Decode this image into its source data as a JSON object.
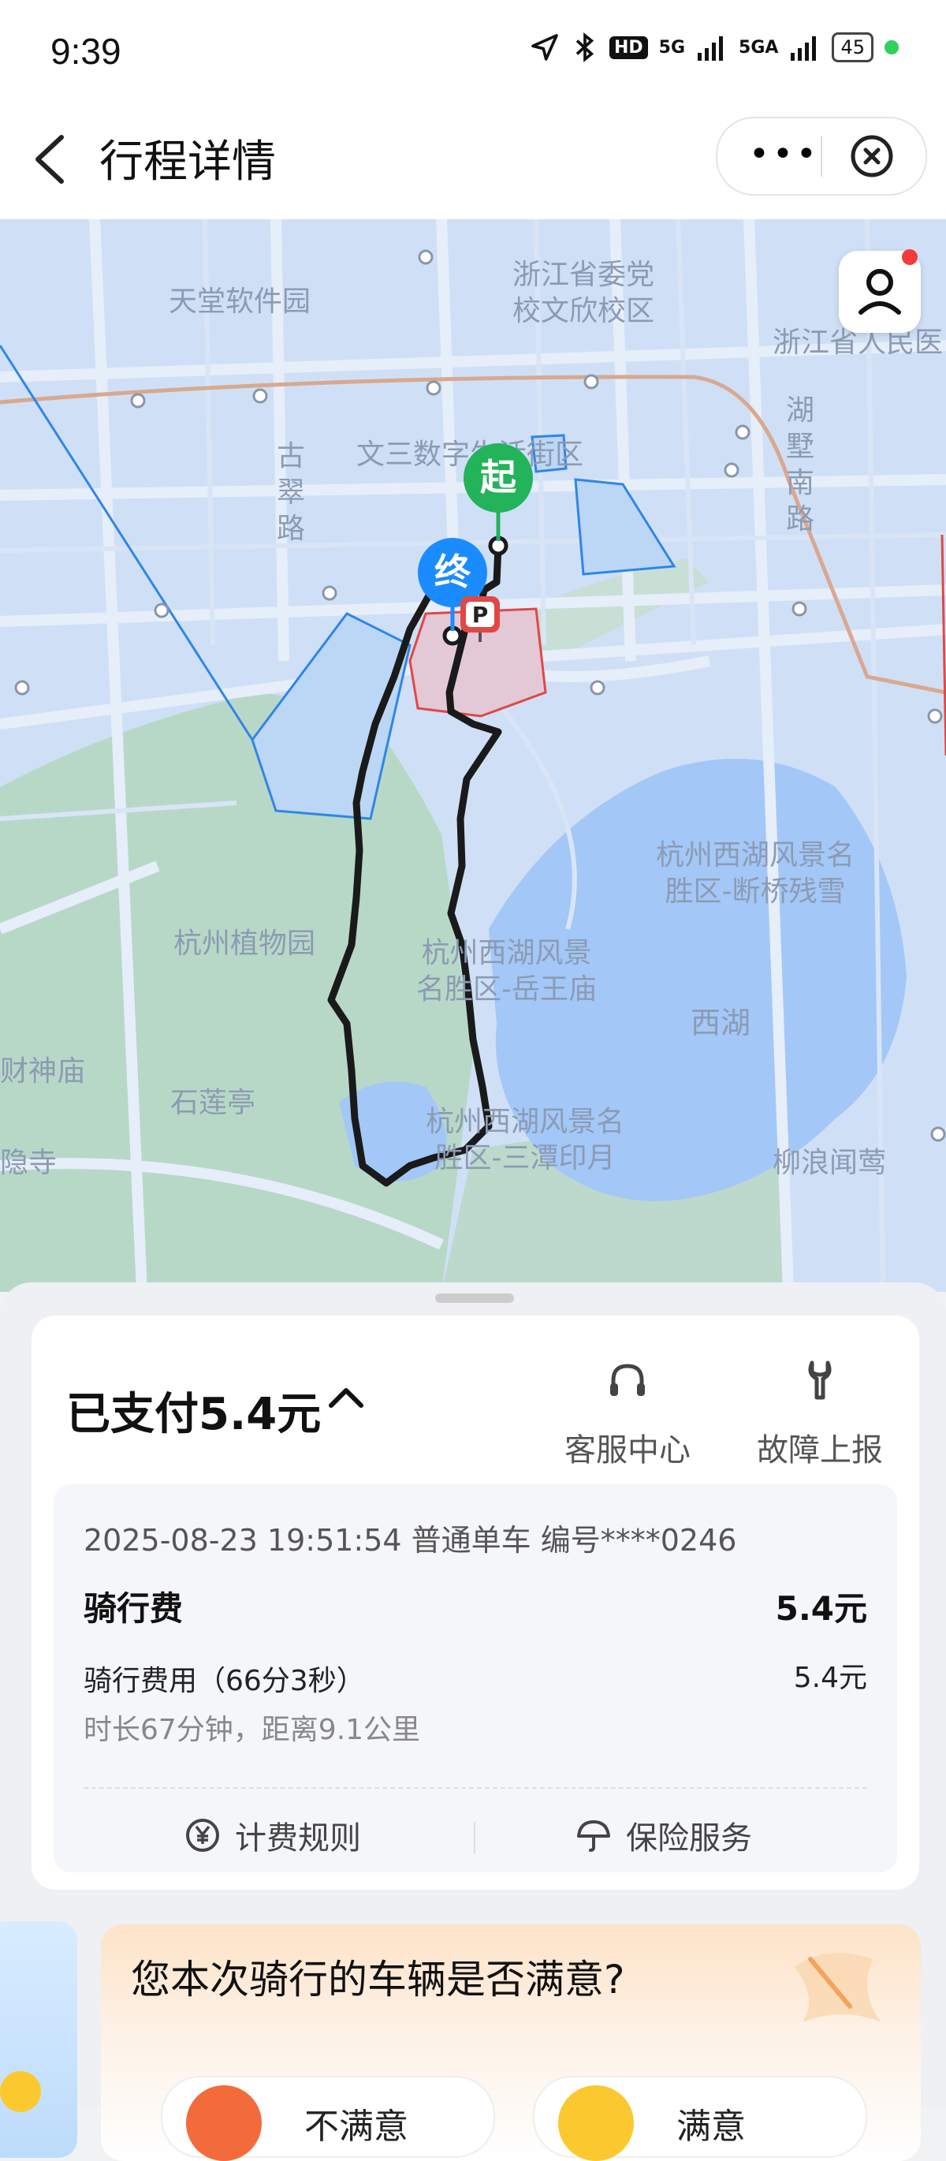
{
  "status_bar": {
    "time": "9:39",
    "hd_badge": "HD",
    "network_1": "5G",
    "network_2": "5GA",
    "battery": "45"
  },
  "navbar": {
    "title": "行程详情",
    "more_label": "•••"
  },
  "map": {
    "labels": [
      "天堂软件园",
      "浙江省委党\n校文欣校区",
      "浙江省人民医",
      "文三数字生活街区",
      "古\n翠\n路",
      "湖\n墅\n南\n路",
      "杭州西湖风景名\n胜区-断桥残雪",
      "杭州植物园",
      "杭州西湖风景\n名胜区-岳王庙",
      "西湖",
      "财神庙",
      "石莲亭",
      "杭州西湖风景名\n胜区-三潭印月",
      "柳浪闻莺",
      "隐寺"
    ],
    "start_marker": "起",
    "end_marker": "终",
    "parking_marker": "P"
  },
  "summary": {
    "paid_text": "已支付5.4元",
    "customer_service": "客服中心",
    "report_fault": "故障上报"
  },
  "detail": {
    "header": "2025-08-23 19:51:54 普通单车 编号****0246",
    "fee_label": "骑行费",
    "fee_value": "5.4元",
    "sub_label": "骑行费用（66分3秒）",
    "sub_value": "5.4元",
    "duration": "时长67分钟，距离9.1公里",
    "billing_rules": "计费规则",
    "insurance": "保险服务"
  },
  "survey": {
    "question": "您本次骑行的车辆是否满意?",
    "option_bad": "不满意",
    "option_good": "满意"
  },
  "colors": {
    "route": "#1a1a1a",
    "start_pin": "#23b35a",
    "end_pin": "#1a8cff",
    "zone_blue": "#2f86e8",
    "zone_red": "#e04848",
    "lake": "#a3c7f7"
  }
}
